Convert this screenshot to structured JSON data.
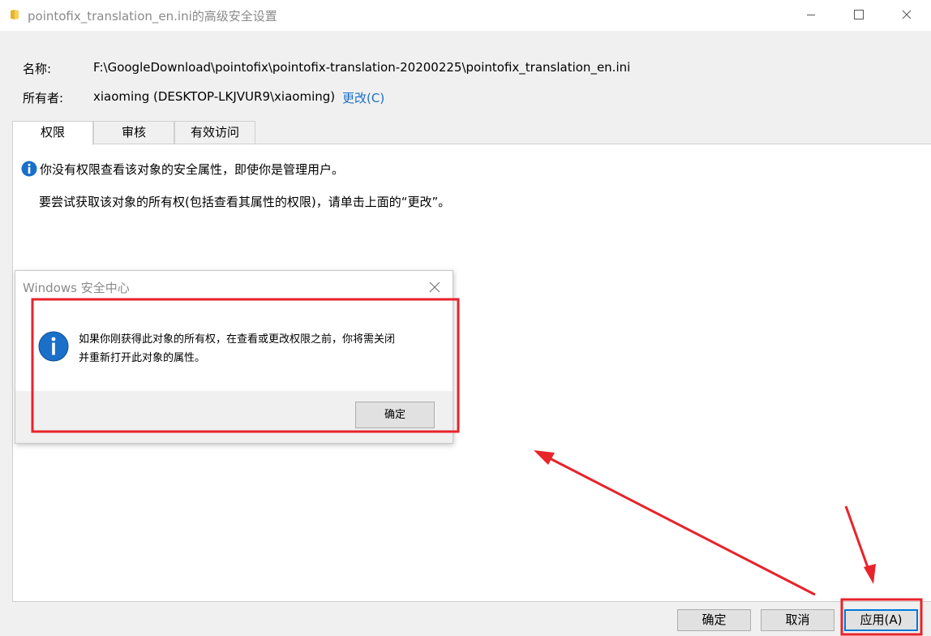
{
  "window": {
    "title": "pointofix_translation_en.ini的高级安全设置"
  },
  "info": {
    "name_label": "名称:",
    "name_value": "F:\\GoogleDownload\\pointofix\\pointofix-translation-20200225\\pointofix_translation_en.ini",
    "owner_label": "所有者:",
    "owner_value": "xiaoming (DESKTOP-LKJVUR9\\xiaoming)",
    "change_link": "更改(C)"
  },
  "tabs": [
    {
      "label": "权限"
    },
    {
      "label": "审核"
    },
    {
      "label": "有效访问"
    }
  ],
  "panel": {
    "message_1": "你没有权限查看该对象的安全属性，即使你是管理用户。",
    "message_2": "要尝试获取该对象的所有权(包括查看其属性的权限)，请单击上面的“更改”。"
  },
  "buttons": {
    "ok": "确定",
    "cancel": "取消",
    "apply": "应用(A)"
  },
  "dialog": {
    "title": "Windows 安全中心",
    "line_1": "如果你刚获得此对象的所有权，在查看或更改权限之前，你将需关闭",
    "line_2": "并重新打开此对象的属性。",
    "ok": "确定"
  },
  "colors": {
    "link": "#1a6fc9",
    "info_icon": "#1a6fc9",
    "annotation": "#e8232a",
    "focus_border": "#0078d7"
  },
  "icons": {
    "title": "folder-icon",
    "info": "info-icon"
  }
}
